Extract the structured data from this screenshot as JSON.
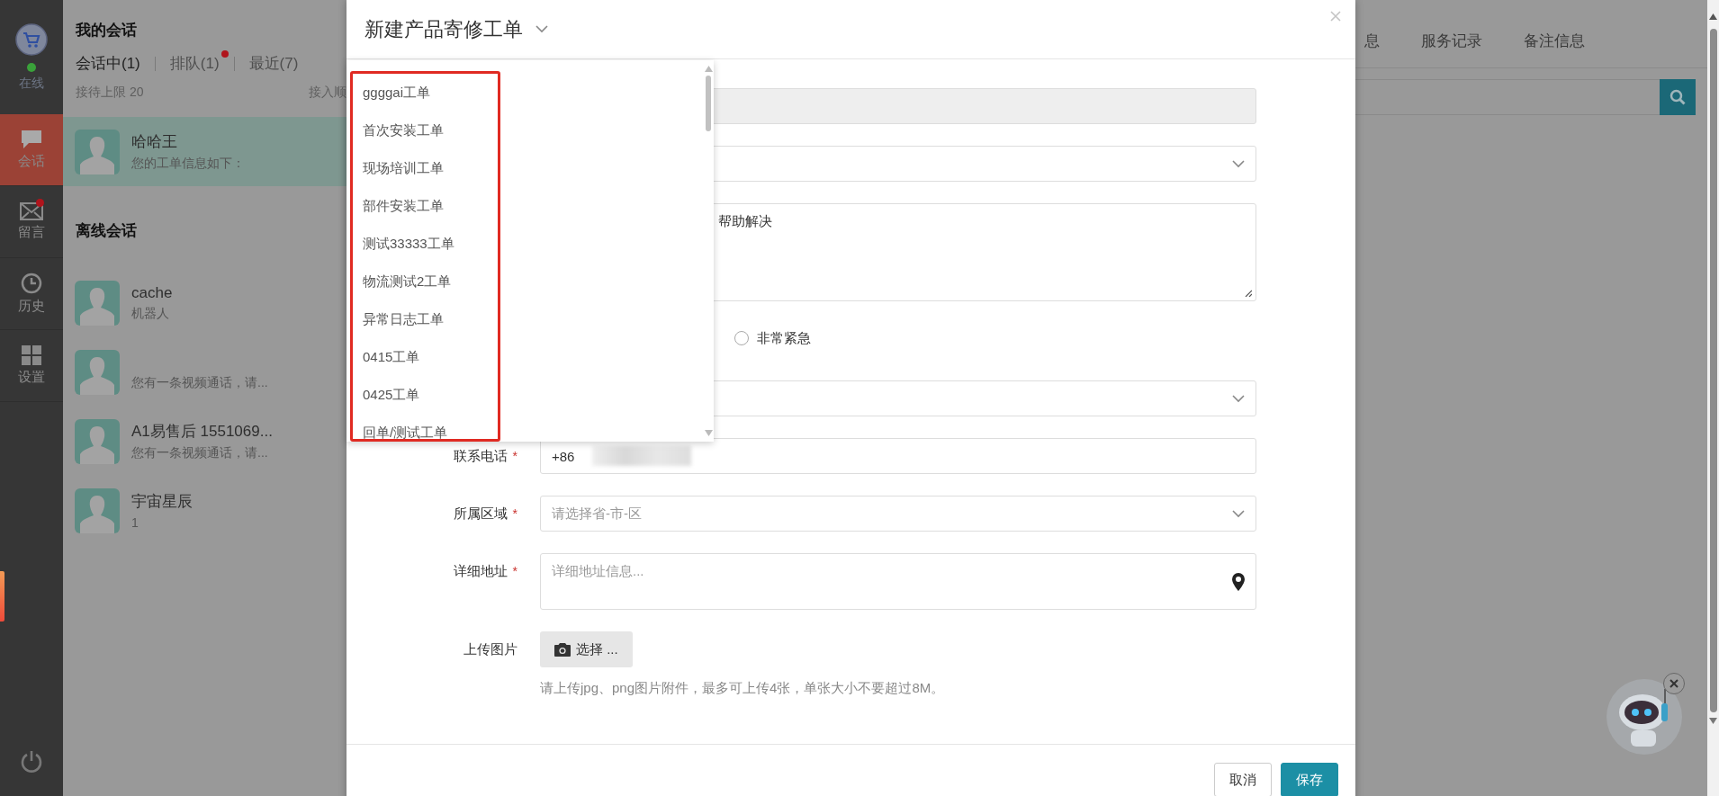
{
  "nav": {
    "status": "在线",
    "items": [
      {
        "label": "会话",
        "selected": true,
        "badge": false
      },
      {
        "label": "留言",
        "selected": false,
        "badge": true
      },
      {
        "label": "历史",
        "selected": false,
        "badge": false
      },
      {
        "label": "设置",
        "selected": false,
        "badge": false
      }
    ]
  },
  "sessions": {
    "title": "我的会话",
    "tabs": [
      {
        "label": "会话中(1)",
        "selected": true,
        "badge": false
      },
      {
        "label": "排队(1)",
        "selected": false,
        "badge": true
      },
      {
        "label": "最近(7)",
        "selected": false,
        "badge": false
      }
    ],
    "limit": "接待上限 20",
    "order": "接入顺",
    "active": [
      {
        "name": "哈哈王",
        "preview": "您的工单信息如下：",
        "selected": true
      }
    ],
    "offline_title": "离线会话",
    "offline": [
      {
        "name": "cache",
        "preview": "机器人",
        "selected": false
      },
      {
        "preview": "您有一条视频通话，请...",
        "selected": false
      },
      {
        "name": "A1易售后 1551069...",
        "preview": "您有一条视频通话，请...",
        "selected": false
      },
      {
        "name": "宇宙星辰",
        "preview": "1",
        "selected": false
      }
    ]
  },
  "right": {
    "tabs": [
      "息",
      "服务记录",
      "备注信息"
    ]
  },
  "modal": {
    "title": "新建产品寄修工单",
    "required_mark": "*",
    "type_options": [
      "ggggai工单",
      "首次安装工单",
      "现场培训工单",
      "部件安装工单",
      "测试33333工单",
      "物流测试2工单",
      "异常日志工单",
      "0415工单",
      "0425工单",
      "回单/测试工单"
    ],
    "fields": [
      {
        "kind": "disabled"
      },
      {
        "kind": "select"
      },
      {
        "kind": "textarea",
        "value": "帮助解决"
      },
      {
        "kind": "radio",
        "options": [
          {
            "label": "非常紧急",
            "selected": false
          }
        ]
      },
      {
        "kind": "select"
      },
      {
        "kind": "phone",
        "label": "联系电话",
        "required": true,
        "prefix": "+86"
      },
      {
        "kind": "select",
        "label": "所属区域",
        "required": true,
        "placeholder": "请选择省-市-区"
      },
      {
        "kind": "address",
        "label": "详细地址",
        "required": true,
        "placeholder": "详细地址信息..."
      },
      {
        "kind": "upload",
        "label": "上传图片",
        "button": "选择 ...",
        "hint": "请上传jpg、png图片附件，最多可上传4张，单张大小不要超过8M。"
      }
    ],
    "buttons": [
      {
        "label": "取消",
        "kind": "default"
      },
      {
        "label": "保存",
        "kind": "primary"
      }
    ]
  }
}
